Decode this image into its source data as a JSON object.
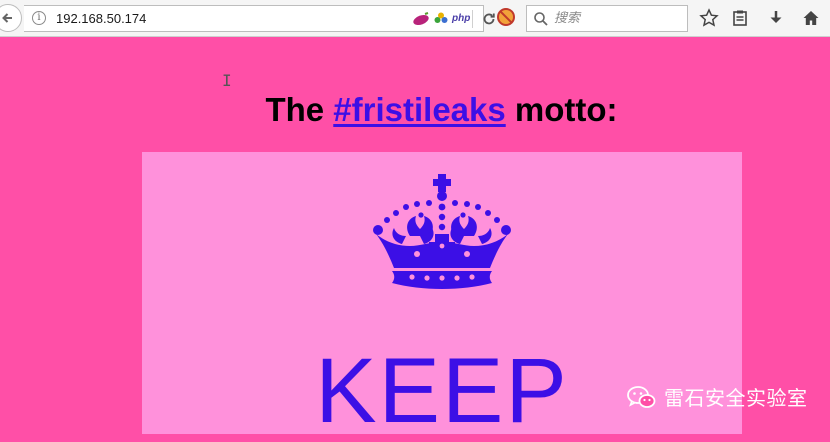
{
  "browser": {
    "url": "192.168.50.174",
    "search_placeholder": "搜索",
    "extension_label": "php"
  },
  "page": {
    "heading_prefix": "The",
    "heading_link": "#fristileaks",
    "heading_suffix": "motto:",
    "poster_text": "KEEP"
  },
  "watermark": {
    "text": "雷石安全实验室"
  },
  "colors": {
    "page_background": "#ff4fa7",
    "poster_background": "#ff91db",
    "accent": "#3c0fe6"
  }
}
